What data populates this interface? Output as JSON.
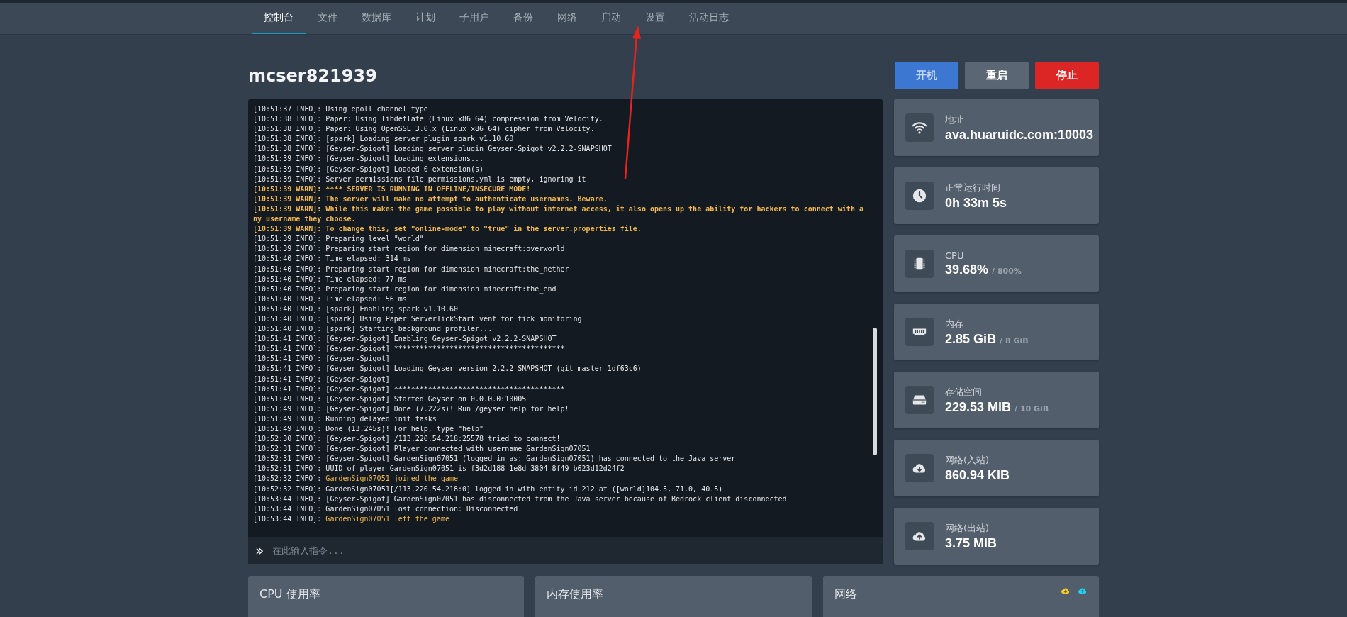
{
  "nav": {
    "tabs": [
      {
        "label": "控制台",
        "selected": true
      },
      {
        "label": "文件",
        "selected": false
      },
      {
        "label": "数据库",
        "selected": false
      },
      {
        "label": "计划",
        "selected": false
      },
      {
        "label": "子用户",
        "selected": false
      },
      {
        "label": "备份",
        "selected": false
      },
      {
        "label": "网络",
        "selected": false
      },
      {
        "label": "启动",
        "selected": false
      },
      {
        "label": "设置",
        "selected": false
      },
      {
        "label": "活动日志",
        "selected": false
      }
    ]
  },
  "server": {
    "name": "mcser821939"
  },
  "power_buttons": [
    {
      "label": "开机",
      "kind": "start"
    },
    {
      "label": "重启",
      "kind": "restart"
    },
    {
      "label": "停止",
      "kind": "stop"
    }
  ],
  "console": {
    "lines": [
      {
        "prefix": "[10:51:37 INFO]:",
        "text": "Using epoll channel type",
        "kind": "normal"
      },
      {
        "prefix": "[10:51:38 INFO]:",
        "text": "Paper: Using libdeflate (Linux x86_64) compression from Velocity.",
        "kind": "normal"
      },
      {
        "prefix": "[10:51:38 INFO]:",
        "text": "Paper: Using OpenSSL 3.0.x (Linux x86_64) cipher from Velocity.",
        "kind": "normal"
      },
      {
        "prefix": "[10:51:38 INFO]:",
        "text": "[spark] Loading server plugin spark v1.10.60",
        "kind": "normal"
      },
      {
        "prefix": "[10:51:38 INFO]:",
        "text": "[Geyser-Spigot] Loading server plugin Geyser-Spigot v2.2.2-SNAPSHOT",
        "kind": "normal"
      },
      {
        "prefix": "[10:51:39 INFO]:",
        "text": "[Geyser-Spigot] Loading extensions...",
        "kind": "normal"
      },
      {
        "prefix": "[10:51:39 INFO]:",
        "text": "[Geyser-Spigot] Loaded 0 extension(s)",
        "kind": "normal"
      },
      {
        "prefix": "[10:51:39 INFO]:",
        "text": "Server permissions file permissions.yml is empty, ignoring it",
        "kind": "normal"
      },
      {
        "prefix": "[10:51:39 WARN]:",
        "text": "**** SERVER IS RUNNING IN OFFLINE/INSECURE MODE!",
        "kind": "warn"
      },
      {
        "prefix": "[10:51:39 WARN]:",
        "text": "The server will make no attempt to authenticate usernames. Beware.",
        "kind": "warn"
      },
      {
        "prefix": "[10:51:39 WARN]:",
        "text": "While this makes the game possible to play without internet access, it also opens up the ability for hackers to connect with any username they choose.",
        "kind": "warn"
      },
      {
        "prefix": "[10:51:39 WARN]:",
        "text": "To change this, set \"online-mode\" to \"true\" in the server.properties file.",
        "kind": "warn"
      },
      {
        "prefix": "[10:51:39 INFO]:",
        "text": "Preparing level \"world\"",
        "kind": "normal"
      },
      {
        "prefix": "[10:51:39 INFO]:",
        "text": "Preparing start region for dimension minecraft:overworld",
        "kind": "normal"
      },
      {
        "prefix": "[10:51:40 INFO]:",
        "text": "Time elapsed: 314 ms",
        "kind": "normal"
      },
      {
        "prefix": "[10:51:40 INFO]:",
        "text": "Preparing start region for dimension minecraft:the_nether",
        "kind": "normal"
      },
      {
        "prefix": "[10:51:40 INFO]:",
        "text": "Time elapsed: 77 ms",
        "kind": "normal"
      },
      {
        "prefix": "[10:51:40 INFO]:",
        "text": "Preparing start region for dimension minecraft:the_end",
        "kind": "normal"
      },
      {
        "prefix": "[10:51:40 INFO]:",
        "text": "Time elapsed: 56 ms",
        "kind": "normal"
      },
      {
        "prefix": "[10:51:40 INFO]:",
        "text": "[spark] Enabling spark v1.10.60",
        "kind": "normal"
      },
      {
        "prefix": "[10:51:40 INFO]:",
        "text": "[spark] Using Paper ServerTickStartEvent for tick monitoring",
        "kind": "normal"
      },
      {
        "prefix": "[10:51:40 INFO]:",
        "text": "[spark] Starting background profiler...",
        "kind": "normal"
      },
      {
        "prefix": "[10:51:41 INFO]:",
        "text": "[Geyser-Spigot] Enabling Geyser-Spigot v2.2.2-SNAPSHOT",
        "kind": "normal"
      },
      {
        "prefix": "[10:51:41 INFO]:",
        "text": "[Geyser-Spigot] ****************************************",
        "kind": "normal"
      },
      {
        "prefix": "[10:51:41 INFO]:",
        "text": "[Geyser-Spigot]",
        "kind": "normal"
      },
      {
        "prefix": "[10:51:41 INFO]:",
        "text": "[Geyser-Spigot] Loading Geyser version 2.2.2-SNAPSHOT (git-master-1df63c6)",
        "kind": "normal"
      },
      {
        "prefix": "[10:51:41 INFO]:",
        "text": "[Geyser-Spigot]",
        "kind": "normal"
      },
      {
        "prefix": "[10:51:41 INFO]:",
        "text": "[Geyser-Spigot] ****************************************",
        "kind": "normal"
      },
      {
        "prefix": "[10:51:49 INFO]:",
        "text": "[Geyser-Spigot] Started Geyser on 0.0.0.0:10005",
        "kind": "normal"
      },
      {
        "prefix": "[10:51:49 INFO]:",
        "text": "[Geyser-Spigot] Done (7.222s)! Run /geyser help for help!",
        "kind": "normal"
      },
      {
        "prefix": "[10:51:49 INFO]:",
        "text": "Running delayed init tasks",
        "kind": "normal"
      },
      {
        "prefix": "[10:51:49 INFO]:",
        "text": "Done (13.245s)! For help, type \"help\"",
        "kind": "normal"
      },
      {
        "prefix": "[10:52:30 INFO]:",
        "text": "[Geyser-Spigot] /113.220.54.218:25578 tried to connect!",
        "kind": "normal"
      },
      {
        "prefix": "[10:52:31 INFO]:",
        "text": "[Geyser-Spigot] Player connected with username GardenSign07051",
        "kind": "normal"
      },
      {
        "prefix": "[10:52:31 INFO]:",
        "text": "[Geyser-Spigot] GardenSign07051 (logged in as: GardenSign07051) has connected to the Java server",
        "kind": "normal"
      },
      {
        "prefix": "[10:52:31 INFO]:",
        "text": "UUID of player GardenSign07051 is f3d2d188-1e8d-3804-8f49-b623d12d24f2",
        "kind": "normal"
      },
      {
        "prefix": "[10:52:32 INFO]:",
        "text": "GardenSign07051 joined the game",
        "kind": "event"
      },
      {
        "prefix": "[10:52:32 INFO]:",
        "text": "GardenSign07051[/113.220.54.218:0] logged in with entity id 212 at ([world]104.5, 71.0, 40.5)",
        "kind": "normal"
      },
      {
        "prefix": "[10:53:44 INFO]:",
        "text": "[Geyser-Spigot] GardenSign07051 has disconnected from the Java server because of Bedrock client disconnected",
        "kind": "normal"
      },
      {
        "prefix": "[10:53:44 INFO]:",
        "text": "GardenSign07051 lost connection: Disconnected",
        "kind": "normal"
      },
      {
        "prefix": "[10:53:44 INFO]:",
        "text": "GardenSign07051 left the game",
        "kind": "event"
      }
    ],
    "command_input": {
      "prompt": "»",
      "placeholder": "在此输入指令..."
    }
  },
  "stats": [
    {
      "kind": "wifi",
      "label": "地址",
      "value": "ava.huaruidc.com:10003"
    },
    {
      "kind": "clock",
      "label": "正常运行时间",
      "value": "0h 33m 5s"
    },
    {
      "kind": "chip",
      "label": "CPU",
      "value": "39.68%",
      "limit": "/ 800%"
    },
    {
      "kind": "memory",
      "label": "内存",
      "value": "2.85 GiB",
      "limit": "/ 8 GiB"
    },
    {
      "kind": "drive",
      "label": "存储空间",
      "value": "229.53 MiB",
      "limit": "/ 10 GiB"
    },
    {
      "kind": "download",
      "label": "网络(入站)",
      "value": "860.94 KiB"
    },
    {
      "kind": "upload",
      "label": "网络(出站)",
      "value": "3.75 MiB"
    }
  ],
  "graphs": [
    {
      "title": "CPU 使用率",
      "legend": false
    },
    {
      "title": "内存使用率",
      "legend": false
    },
    {
      "title": "网络",
      "legend": true
    }
  ]
}
